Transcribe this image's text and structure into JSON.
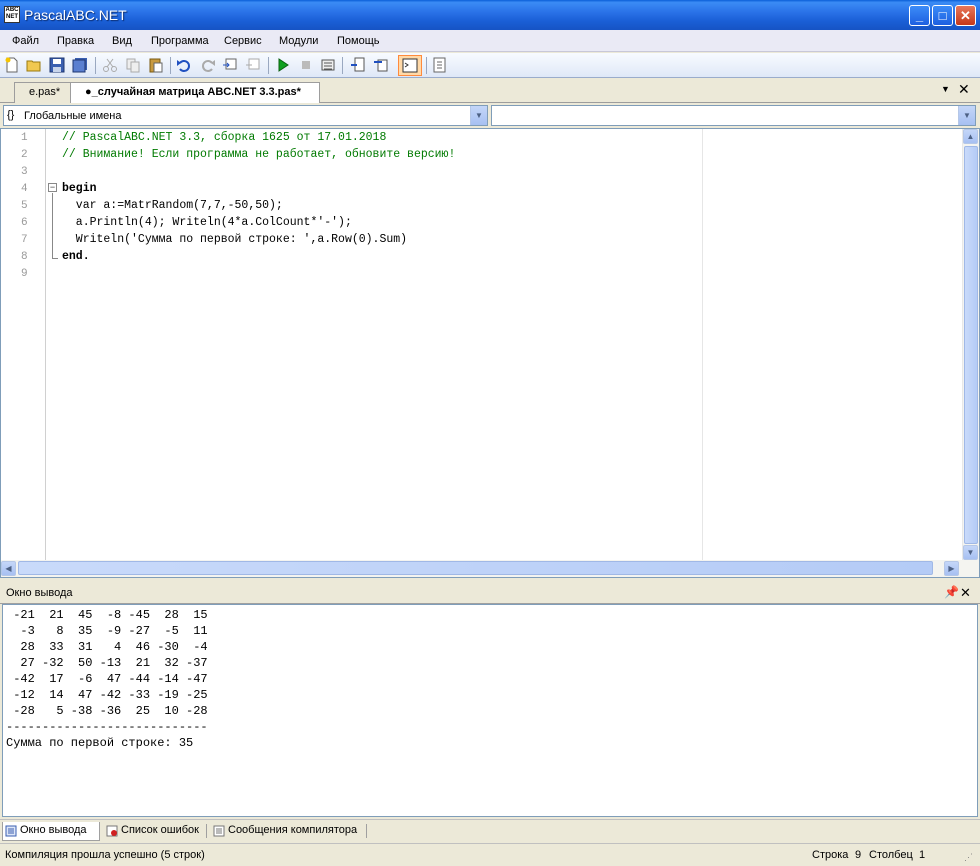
{
  "window": {
    "title": "PascalABC.NET",
    "app_icon_text": "ABC NET"
  },
  "menu": [
    "Файл",
    "Правка",
    "Вид",
    "Программа",
    "Сервис",
    "Модули",
    "Помощь"
  ],
  "tabs": [
    {
      "label": "e.pas*"
    },
    {
      "label": "●_случайная матрица ABC.NET 3.3.pas*"
    }
  ],
  "scope": {
    "left_value": "Глобальные имена",
    "right_value": ""
  },
  "editor": {
    "line_numbers": [
      "1",
      "2",
      "3",
      "4",
      "5",
      "6",
      "7",
      "8",
      "9"
    ],
    "lines": [
      "// PascalABC.NET 3.3, сборка 1625 от 17.01.2018",
      "// Внимание! Если программа не работает, обновите версию!",
      "",
      "begin",
      "  var a:=MatrRandom(7,7,-50,50);",
      "  a.Println(4); Writeln(4*a.ColCount*'-');",
      "  Writeln('Сумма по первой строке: ',a.Row(0).Sum)",
      "end.",
      ""
    ]
  },
  "output": {
    "title": "Окно вывода",
    "text": " -21  21  45  -8 -45  28  15\n  -3   8  35  -9 -27  -5  11\n  28  33  31   4  46 -30  -4\n  27 -32  50 -13  21  32 -37\n -42  17  -6  47 -44 -14 -47\n -12  14  47 -42 -33 -19 -25\n -28   5 -38 -36  25  10 -28\n----------------------------\nСумма по первой строке: 35"
  },
  "bottom_tabs": [
    "Окно вывода",
    "Список ошибок",
    "Сообщения компилятора"
  ],
  "status": {
    "message": "Компиляция прошла успешно (5 строк)",
    "row_label": "Строка",
    "row_value": "9",
    "col_label": "Столбец",
    "col_value": "1"
  }
}
